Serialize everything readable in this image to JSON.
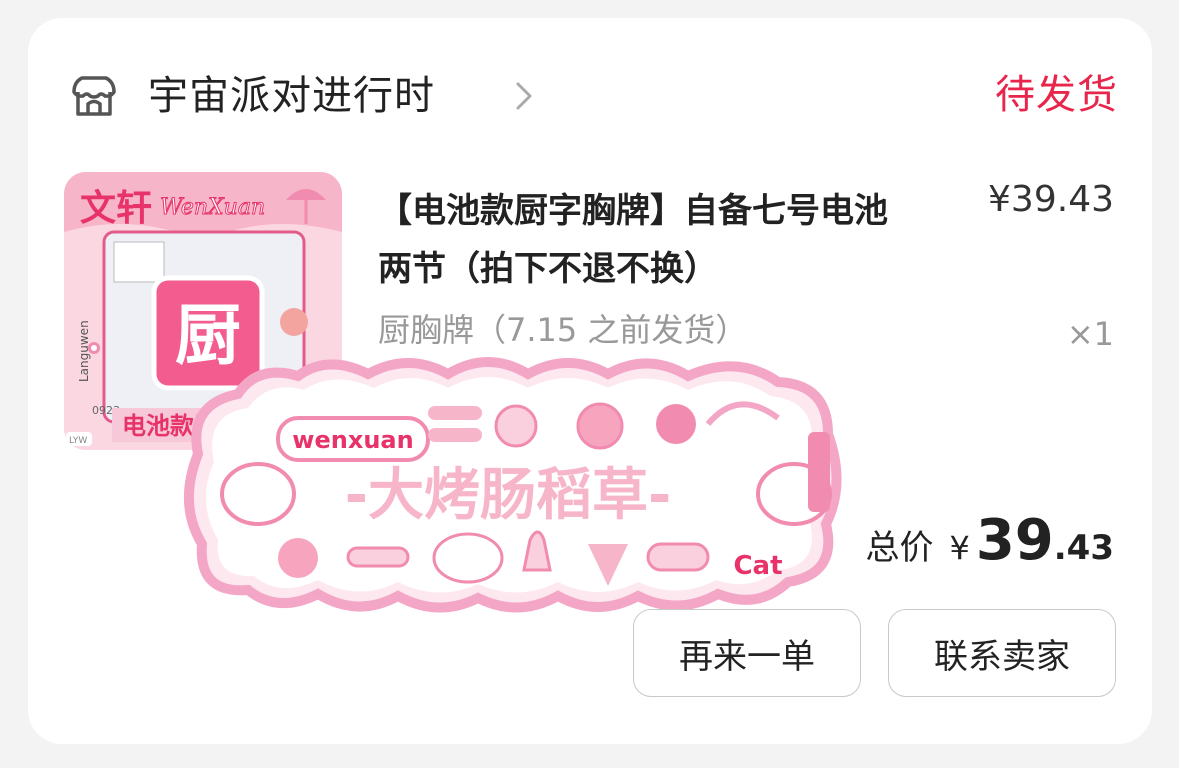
{
  "order": {
    "shop_name": "宇宙派对进行时",
    "status": "待发货"
  },
  "product": {
    "title": "【电池款厨字胸牌】自备七号电池两节（拍下不退不换）",
    "price": "¥39.43",
    "variant": "厨胸牌（7.15 之前发货）",
    "quantity": "×1",
    "thumbnail": {
      "top_text": "文轩",
      "brand_script": "WenXuan",
      "center_char": "厨",
      "bottom_text": "电池款厨",
      "side_text": "Languwen",
      "code": "0923",
      "corner_tag": "LYW"
    }
  },
  "sticker": {
    "bubble_text": "wenxuan",
    "main_text": "-大烤肠稻草-",
    "small_text": "Cat"
  },
  "summary": {
    "total_label": "总价",
    "currency": "¥",
    "total_int": "39",
    "total_dec": ".43"
  },
  "actions": {
    "reorder": "再来一单",
    "contact_seller": "联系卖家"
  },
  "colors": {
    "status": "#e8264b",
    "sticker_pink": "#f4a6c6",
    "thumb_bg": "#fbd7e2"
  }
}
